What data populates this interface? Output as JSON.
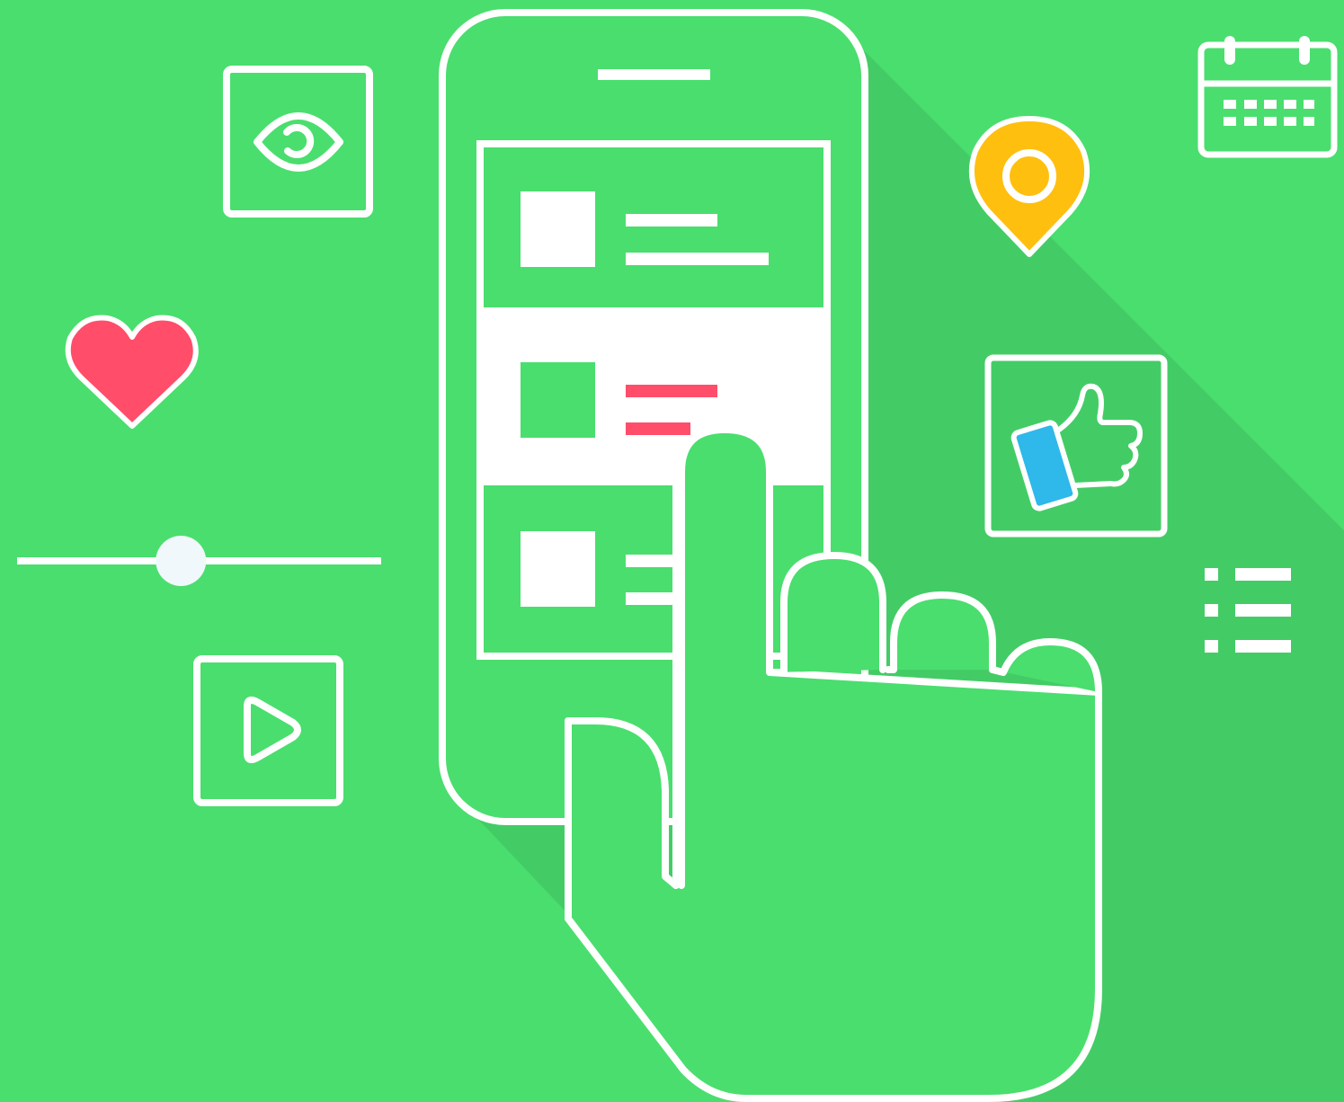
{
  "colors": {
    "background": "#4ade6e",
    "shadow": "#43cc66",
    "outline": "#ffffff",
    "highlight_row": "#ffffff",
    "heart": "#ff4d6a",
    "pin": "#ffbf0f",
    "thumb_cuff": "#2fb8ea",
    "accent_lines": "#ff4d6a"
  },
  "icons": {
    "eye": "eye-icon",
    "heart": "heart-icon",
    "slider": "slider",
    "play": "play-icon",
    "location": "location-pin-icon",
    "calendar": "calendar-icon",
    "thumbs_up": "thumbs-up-icon",
    "list": "list-icon",
    "phone": "smartphone",
    "hand": "pointing-hand"
  },
  "phone": {
    "list_items": 3,
    "selected_item": 2
  },
  "slider": {
    "value_fraction": 0.45
  }
}
